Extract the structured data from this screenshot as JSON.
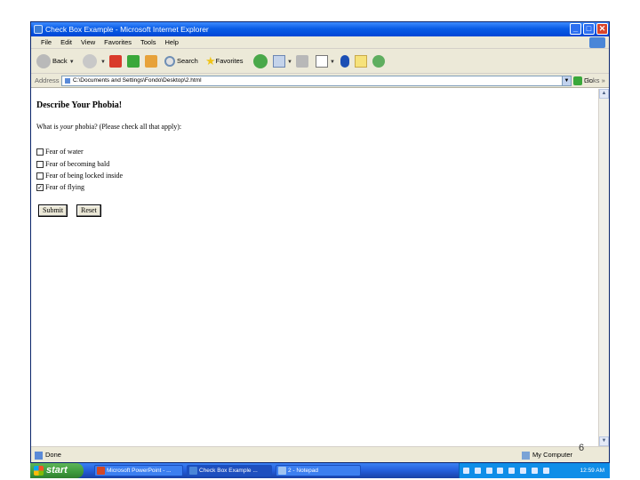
{
  "window": {
    "title": "Check Box Example - Microsoft Internet Explorer",
    "controls": {
      "minimize": "_",
      "maximize": "□",
      "close": "✕"
    }
  },
  "menubar": {
    "items": [
      "File",
      "Edit",
      "View",
      "Favorites",
      "Tools",
      "Help"
    ]
  },
  "toolbar": {
    "back_label": "Back",
    "search_label": "Search",
    "favorites_label": "Favorites"
  },
  "address": {
    "label": "Address",
    "value": "C:\\Documents and Settings\\Fondo\\Desktop\\2.html",
    "go_label": "Go",
    "links_label": "Links »"
  },
  "page": {
    "heading": "Describe Your Phobia!",
    "question_prefix": "What is ",
    "question_em": "your",
    "question_suffix": " phobia? (Please check all that apply):",
    "options": [
      {
        "label": "Fear of water",
        "checked": false
      },
      {
        "label": "Fear of becoming bald",
        "checked": false
      },
      {
        "label": "Fear of being locked inside",
        "checked": false
      },
      {
        "label": "Fear of flying",
        "checked": true
      }
    ],
    "submit_label": "Submit",
    "reset_label": "Reset"
  },
  "statusbar": {
    "status_text": "Done",
    "zone_text": "My Computer"
  },
  "slide_number": "6",
  "taskbar": {
    "start_label": "start",
    "tasks": [
      {
        "label": "Microsoft PowerPoint - ...",
        "active": false,
        "icon_color": "#d24726"
      },
      {
        "label": "Check Box Example ...",
        "active": true,
        "icon_color": "#4a86d8"
      },
      {
        "label": "2 - Notepad",
        "active": false,
        "icon_color": "#9fc3f0"
      }
    ],
    "clock": "12:59 AM"
  }
}
